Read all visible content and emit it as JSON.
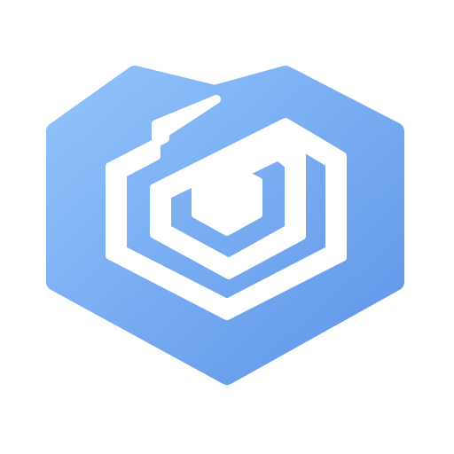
{
  "logo": {
    "icon": "hexagon-heart-spiral-logo-icon",
    "colors": {
      "background": "#FFFFFF",
      "gradient_start": "#92C3FB",
      "gradient_end": "#5E95E8",
      "negative_space": "#FFFFFF"
    }
  }
}
